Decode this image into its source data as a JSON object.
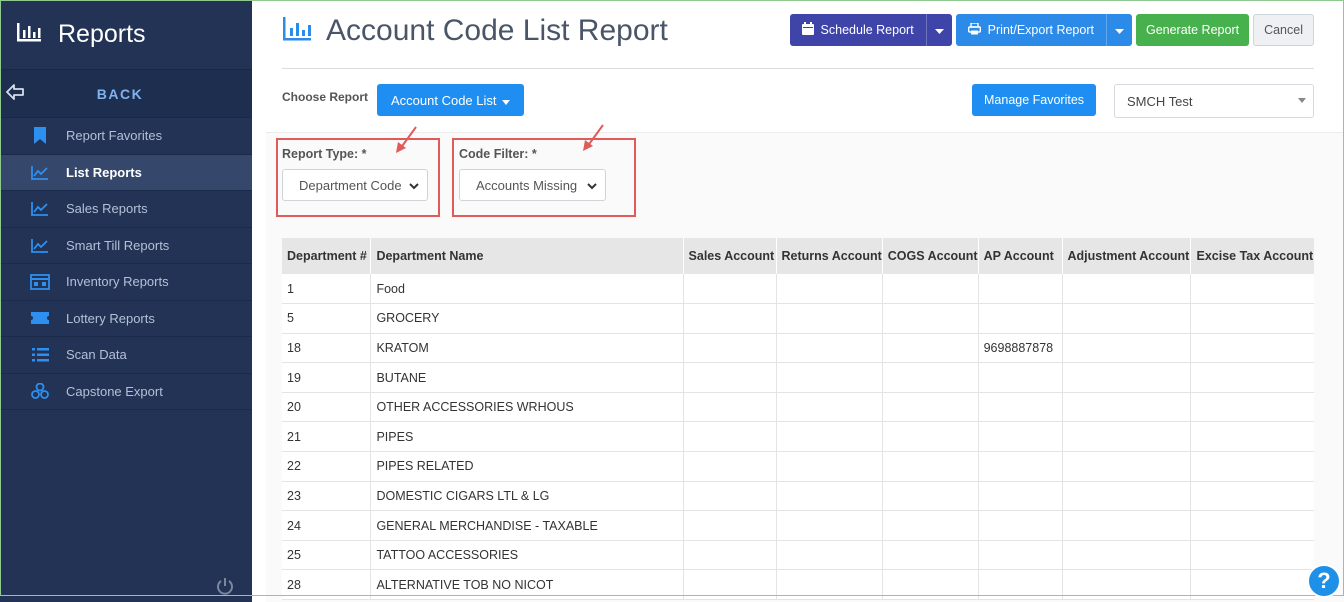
{
  "sidebar": {
    "title": "Reports",
    "back_label": "BACK",
    "items": [
      {
        "label": "Report Favorites",
        "icon": "bookmark-icon"
      },
      {
        "label": "List Reports",
        "icon": "line-chart-icon",
        "active": true
      },
      {
        "label": "Sales Reports",
        "icon": "line-chart-icon"
      },
      {
        "label": "Smart Till Reports",
        "icon": "line-chart-icon"
      },
      {
        "label": "Inventory Reports",
        "icon": "warehouse-icon"
      },
      {
        "label": "Lottery Reports",
        "icon": "ticket-icon"
      },
      {
        "label": "Scan Data",
        "icon": "list-icon"
      },
      {
        "label": "Capstone Export",
        "icon": "cubes-icon"
      }
    ]
  },
  "header": {
    "title": "Account Code List Report",
    "schedule_label": "Schedule Report",
    "print_label": "Print/Export Report",
    "generate_label": "Generate Report",
    "cancel_label": "Cancel"
  },
  "choose": {
    "label": "Choose Report",
    "report_button": "Account Code List",
    "favorites_button": "Manage Favorites",
    "store_value": "SMCH Test"
  },
  "filters": {
    "report_type_label": "Report Type: *",
    "report_type_value": "Department Code",
    "code_filter_label": "Code Filter: *",
    "code_filter_value": "Accounts Missing"
  },
  "table": {
    "columns": [
      "Department #",
      "Department Name",
      "Sales Account",
      "Returns Account",
      "COGS Account",
      "AP Account",
      "Adjustment Account",
      "Excise Tax Account"
    ],
    "rows": [
      [
        "1",
        "Food",
        "",
        "",
        "",
        "",
        "",
        ""
      ],
      [
        "5",
        "GROCERY",
        "",
        "",
        "",
        "",
        "",
        ""
      ],
      [
        "18",
        "KRATOM",
        "",
        "",
        "",
        "9698887878",
        "",
        ""
      ],
      [
        "19",
        "BUTANE",
        "",
        "",
        "",
        "",
        "",
        ""
      ],
      [
        "20",
        "OTHER ACCESSORIES WRHOUS",
        "",
        "",
        "",
        "",
        "",
        ""
      ],
      [
        "21",
        "PIPES",
        "",
        "",
        "",
        "",
        "",
        ""
      ],
      [
        "22",
        "PIPES RELATED",
        "",
        "",
        "",
        "",
        "",
        ""
      ],
      [
        "23",
        "DOMESTIC CIGARS LTL & LG",
        "",
        "",
        "",
        "",
        "",
        ""
      ],
      [
        "24",
        "GENERAL MERCHANDISE - TAXABLE",
        "",
        "",
        "",
        "",
        "",
        ""
      ],
      [
        "25",
        "TATTOO ACCESSORIES",
        "",
        "",
        "",
        "",
        "",
        ""
      ],
      [
        "28",
        "ALTERNATIVE TOB NO NICOT",
        "",
        "",
        "",
        "",
        "",
        ""
      ]
    ]
  },
  "help": {
    "symbol": "?"
  },
  "colors": {
    "sidebar": "#223355",
    "primary": "#1f8ef2",
    "schedule": "#3e44a8",
    "generate": "#47b14d",
    "annotation": "#e05a5a"
  }
}
